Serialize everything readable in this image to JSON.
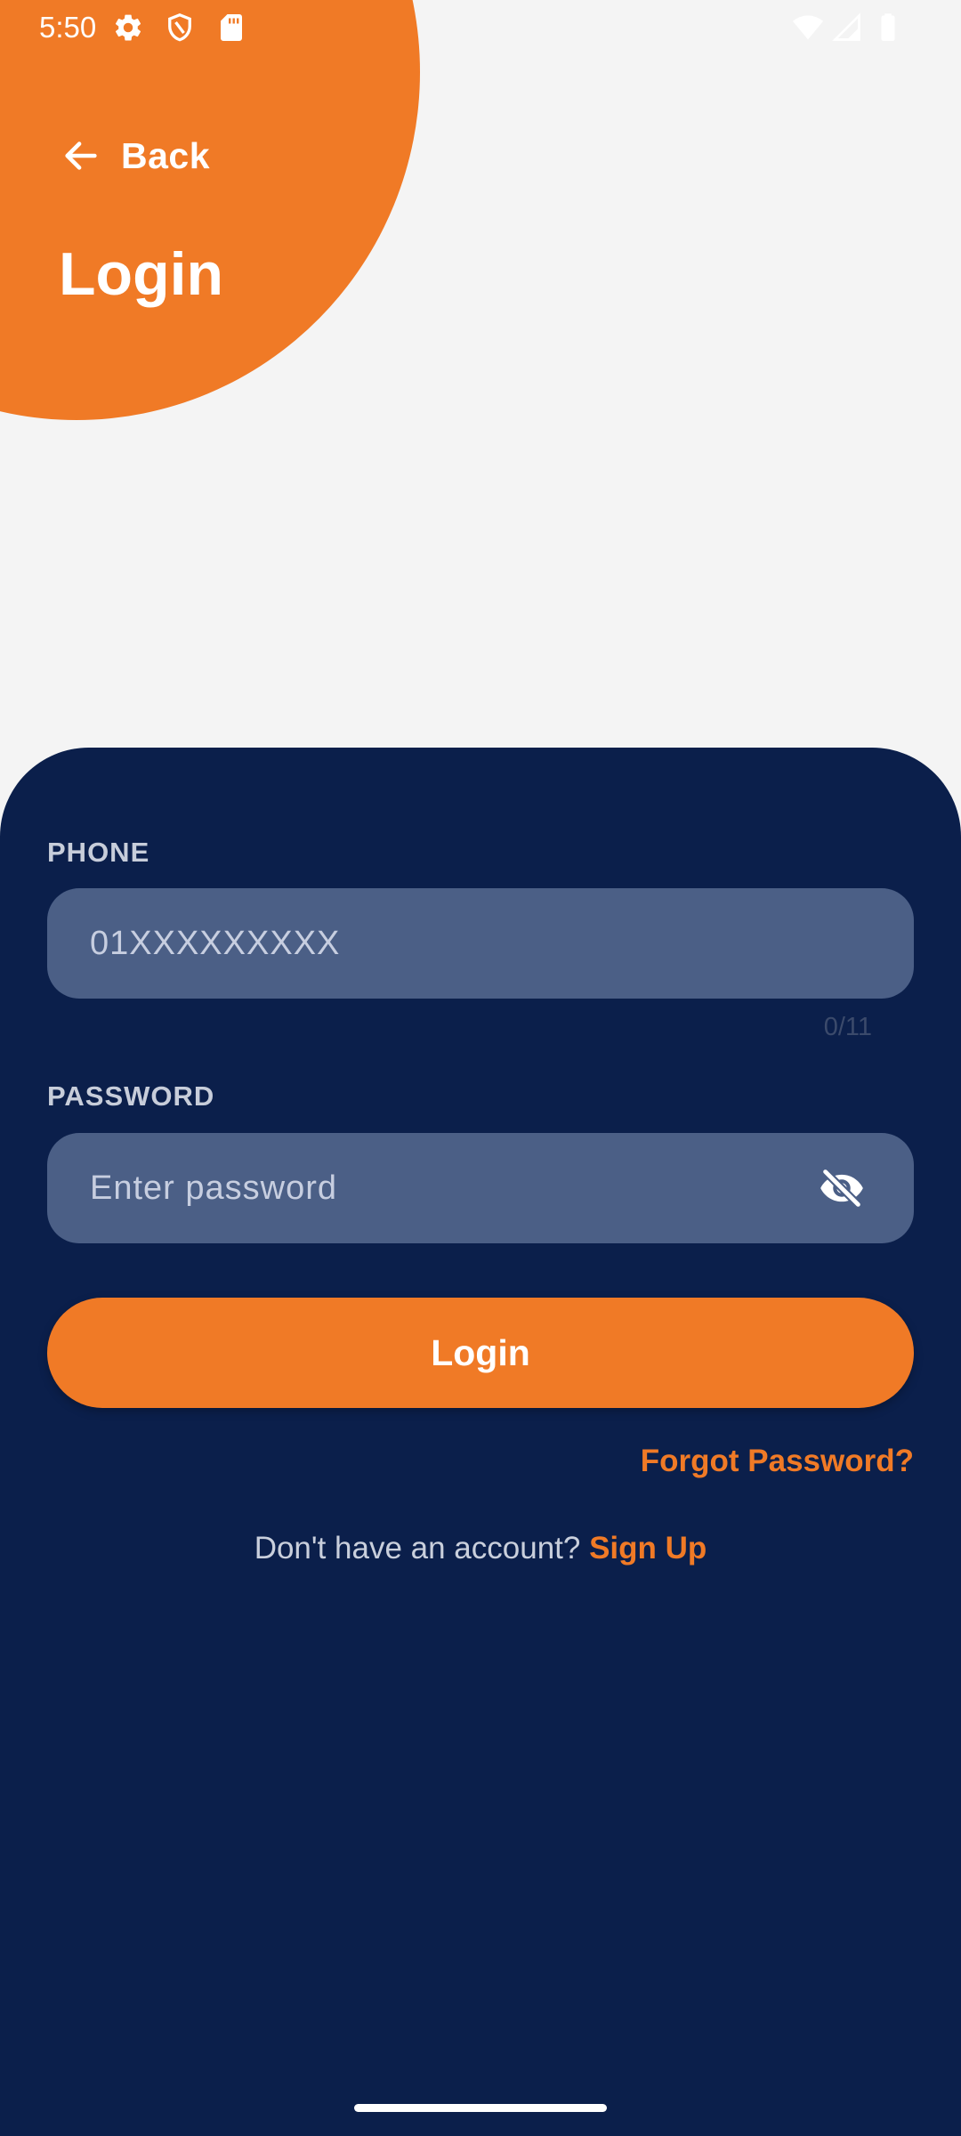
{
  "status_bar": {
    "time": "5:50",
    "left_icons": [
      "gear-icon",
      "shield-icon",
      "sd-card-icon"
    ],
    "right_icons": [
      "wifi-icon",
      "signal-icon",
      "battery-icon"
    ]
  },
  "header": {
    "back_label": "Back",
    "title": "Login"
  },
  "form": {
    "phone": {
      "label": "PHONE",
      "placeholder": "01XXXXXXXXX",
      "value": "",
      "counter": "0/11",
      "maxlength": "11"
    },
    "password": {
      "label": "PASSWORD",
      "placeholder": "Enter password",
      "value": "",
      "visibility_icon": "eye-off-icon"
    },
    "login_label": "Login",
    "forgot_label": "Forgot Password?",
    "signup_prompt": "Don't have an account? ",
    "signup_label": "Sign Up"
  },
  "colors": {
    "accent": "#f07a26",
    "sheet": "#0b1f4b",
    "field": "#4b5f86",
    "background": "#f4f4f4"
  }
}
